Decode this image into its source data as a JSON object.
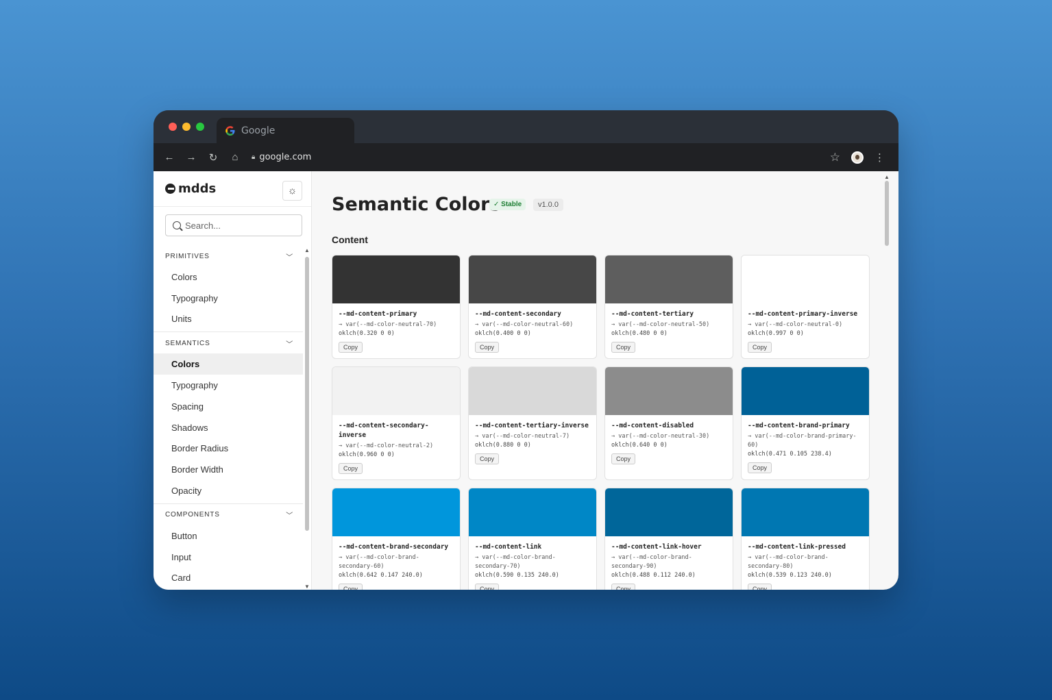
{
  "browser": {
    "tab_title": "Google",
    "url": "google.com",
    "nav": {
      "back": "←",
      "forward": "→",
      "reload": "↻",
      "home": "⌂"
    },
    "star": "☆",
    "menu": "⋮"
  },
  "sidebar": {
    "logo": "mdds",
    "theme_icon": "☼",
    "search_placeholder": "Search...",
    "sections": [
      {
        "title": "PRIMITIVES",
        "items": [
          "Colors",
          "Typography",
          "Units"
        ]
      },
      {
        "title": "SEMANTICS",
        "items": [
          "Colors",
          "Typography",
          "Spacing",
          "Shadows",
          "Border Radius",
          "Border Width",
          "Opacity"
        ]
      },
      {
        "title": "COMPONENTS",
        "items": [
          "Button",
          "Input",
          "Card"
        ]
      }
    ],
    "active": "SEMANTICS/Colors"
  },
  "main": {
    "title": "Semantic Colors",
    "status": "✓ Stable",
    "version": "v1.0.0",
    "section": "Content",
    "copy_label": "Copy",
    "tokens": [
      {
        "name": "--md-content-primary",
        "ref": "→ var(--md-color-neutral-70)",
        "oklch": "oklch(0.320 0 0)",
        "color": "#333333"
      },
      {
        "name": "--md-content-secondary",
        "ref": "→ var(--md-color-neutral-60)",
        "oklch": "oklch(0.400 0 0)",
        "color": "#474747"
      },
      {
        "name": "--md-content-tertiary",
        "ref": "→ var(--md-color-neutral-50)",
        "oklch": "oklch(0.480 0 0)",
        "color": "#5e5e5e"
      },
      {
        "name": "--md-content-primary-inverse",
        "ref": "→ var(--md-color-neutral-0)",
        "oklch": "oklch(0.997 0 0)",
        "color": "#ffffff"
      },
      {
        "name": "--md-content-secondary-inverse",
        "ref": "→ var(--md-color-neutral-2)",
        "oklch": "oklch(0.960 0 0)",
        "color": "#f2f2f2"
      },
      {
        "name": "--md-content-tertiary-inverse",
        "ref": "→ var(--md-color-neutral-7)",
        "oklch": "oklch(0.880 0 0)",
        "color": "#d9d9d9"
      },
      {
        "name": "--md-content-disabled",
        "ref": "→ var(--md-color-neutral-30)",
        "oklch": "oklch(0.640 0 0)",
        "color": "#8c8c8c"
      },
      {
        "name": "--md-content-brand-primary",
        "ref": "→ var(--md-color-brand-primary-60)",
        "oklch": "oklch(0.471 0.105 238.4)",
        "color": "#006197"
      },
      {
        "name": "--md-content-brand-secondary",
        "ref": "→ var(--md-color-brand-secondary-60)",
        "oklch": "oklch(0.642 0.147 240.0)",
        "color": "#0096dc"
      },
      {
        "name": "--md-content-link",
        "ref": "→ var(--md-color-brand-secondary-70)",
        "oklch": "oklch(0.590 0.135 240.0)",
        "color": "#0087c6"
      },
      {
        "name": "--md-content-link-hover",
        "ref": "→ var(--md-color-brand-secondary-90)",
        "oklch": "oklch(0.488 0.112 240.0)",
        "color": "#00669a"
      },
      {
        "name": "--md-content-link-pressed",
        "ref": "→ var(--md-color-brand-secondary-80)",
        "oklch": "oklch(0.539 0.123 240.0)",
        "color": "#0077b2"
      }
    ]
  }
}
